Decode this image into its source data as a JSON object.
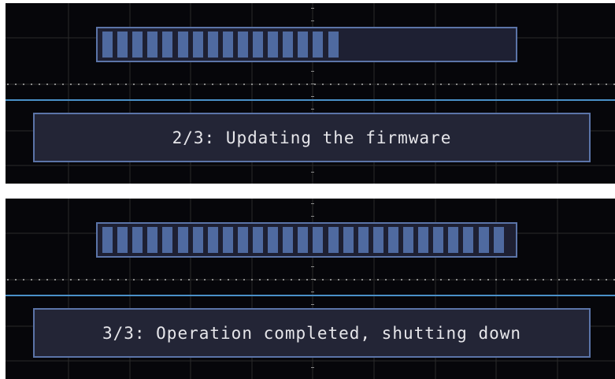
{
  "screens": [
    {
      "progress": {
        "filled_segments": 16,
        "total_segments": 27
      },
      "message": "2/3: Updating the firmware"
    },
    {
      "progress": {
        "filled_segments": 27,
        "total_segments": 27
      },
      "message": "3/3: Operation completed, shutting down"
    }
  ],
  "colors": {
    "screen_bg": "#06060a",
    "grid": "#2a2a2a",
    "trace": "#4a90c8",
    "box_fill": "#232536",
    "box_border": "#5b74a8",
    "segment": "#4f6aa0",
    "text": "#e6e6ea"
  }
}
